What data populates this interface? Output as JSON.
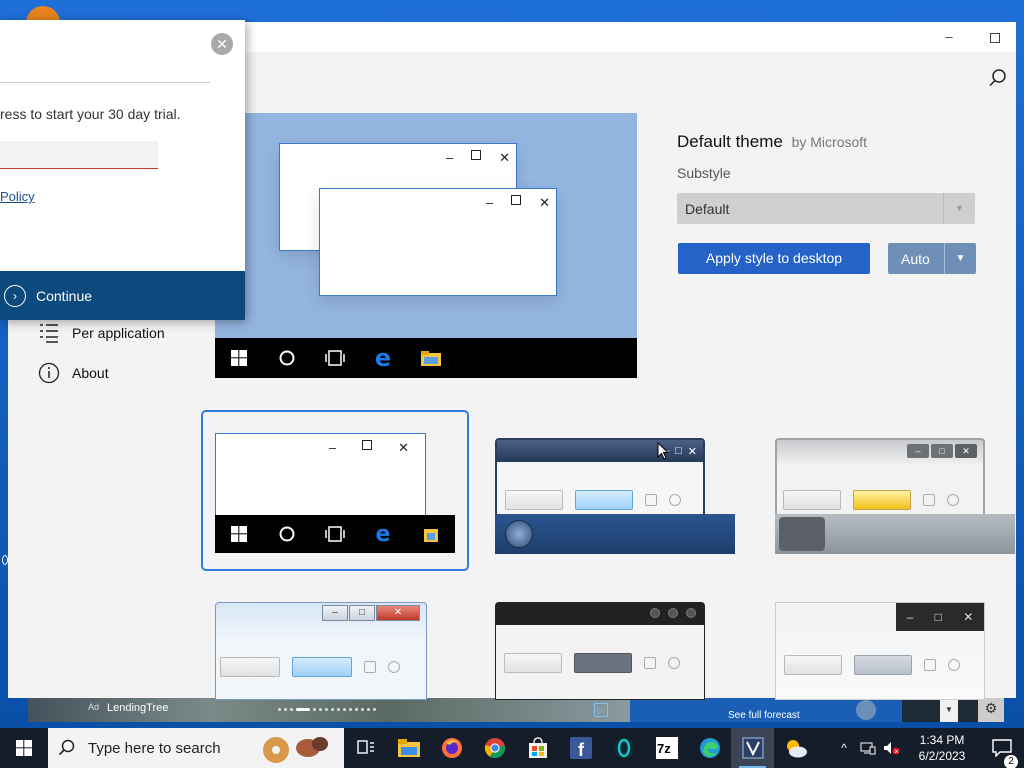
{
  "app": {
    "title_buttons": {
      "minimize": "–"
    },
    "nav": {
      "per_application": "Per application",
      "about": "About"
    },
    "theme": {
      "name": "Default theme",
      "author": "by Microsoft",
      "substyle_label": "Substyle",
      "substyle_value": "Default",
      "apply_button": "Apply style to desktop",
      "auto_button": "Auto"
    },
    "preview": {
      "min_symbol": "–",
      "close_symbol": "✕"
    },
    "thumbnails": [
      {
        "style": "Windows 10",
        "selected": true
      },
      {
        "style": "Windows 7 Basic Dark",
        "selected": false
      },
      {
        "style": "Windows 7 Silver",
        "selected": false
      },
      {
        "style": "Windows Vista Aero",
        "selected": false
      },
      {
        "style": "macOS Dark",
        "selected": false
      },
      {
        "style": "Windows 10 Dark Titlebar",
        "selected": false
      }
    ]
  },
  "dialog": {
    "message": "ress to start your 30 day trial.",
    "policy_link": "Policy",
    "continue_label": "Continue",
    "close_symbol": "✕"
  },
  "background_browser": {
    "ad_tag": "Ad",
    "ad_text": "LendingTree",
    "forecast": "See full forecast"
  },
  "taskbar": {
    "search_placeholder": "Type here to search",
    "time": "1:34 PM",
    "date": "6/2/2023",
    "notifications": "2",
    "apps": [
      "task-view",
      "file-explorer",
      "firefox",
      "chrome",
      "microsoft-store",
      "facebook",
      "opera",
      "7zip",
      "edge",
      "stardock-windowblinds",
      "weather"
    ]
  },
  "colors": {
    "accent": "#2563c9",
    "auto_button": "#6f8fb6",
    "dialog_continue": "#0c4a7d",
    "preview_bg": "#93b5e0",
    "taskbar": "#151d2a"
  }
}
